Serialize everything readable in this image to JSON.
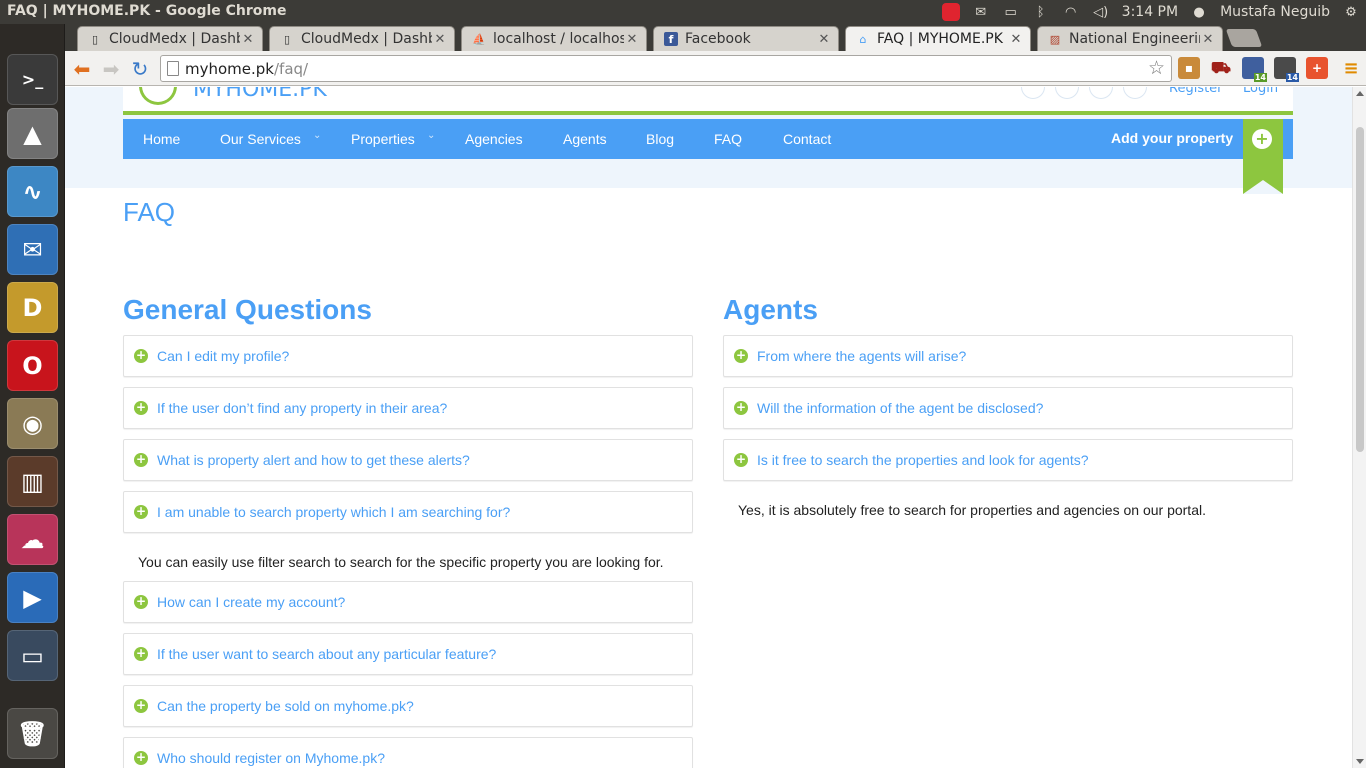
{
  "os": {
    "window_title": "FAQ | MYHOME.PK - Google Chrome",
    "clock": "3:14 PM",
    "user": "Mustafa Neguib"
  },
  "launcher": {
    "items": [
      "terminal-icon",
      "inkscape-icon",
      "system-monitor-icon",
      "thunderbird-icon",
      "dia-icon",
      "opera-icon",
      "gimp-icon",
      "bookshelf-icon",
      "pidgin-icon",
      "media-player-icon",
      "image-viewer-icon",
      "trash-icon"
    ]
  },
  "tabs": [
    {
      "label": "CloudMedx | Dashboa",
      "favicon": "page-icon"
    },
    {
      "label": "CloudMedx | Dashboa",
      "favicon": "page-icon"
    },
    {
      "label": "localhost / localhost /",
      "favicon": "phpmyadmin-icon"
    },
    {
      "label": "Facebook",
      "favicon": "facebook-icon"
    },
    {
      "label": "FAQ | MYHOME.PK",
      "favicon": "home-icon"
    },
    {
      "label": "National Engineering",
      "favicon": "chart-icon"
    }
  ],
  "address_bar": {
    "host": "myhome.pk",
    "path": "/faq/"
  },
  "extensions": {
    "badge_1": "14",
    "badge_2": "14"
  },
  "site": {
    "logo_text": "MYHOME.PK",
    "register": "Register",
    "login": "Login",
    "nav": [
      "Home",
      "Our Services",
      "Properties",
      "Agencies",
      "Agents",
      "Blog",
      "FAQ",
      "Contact"
    ],
    "add_property": "Add your property",
    "page_title": "FAQ"
  },
  "faq": {
    "general_heading": "General Questions",
    "general": [
      "Can I edit my profile?",
      "If the user don’t find any property in their area?",
      "What is property alert and how to get these alerts?",
      "I am unable to search property which I am searching for?",
      "How can I create my account?",
      "If the user want to search about any particular feature?",
      "Can the property be sold on myhome.pk?",
      "Who should register on Myhome.pk?"
    ],
    "general_answer": "You can easily use filter search to search for the specific property you are looking for.",
    "agents_heading": "Agents",
    "agents": [
      "From where the agents will arise?",
      "Will the information of the agent be disclosed?",
      "Is it free to search the properties and look for agents?"
    ],
    "agents_answer": "Yes, it is absolutely free to search for properties and agencies on our portal."
  },
  "colors": {
    "brand_blue": "#4a9ff5",
    "brand_green": "#8dc63f"
  }
}
